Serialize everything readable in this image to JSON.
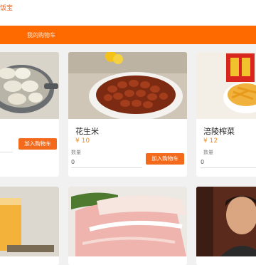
{
  "header": {
    "app_title": "饭宝"
  },
  "nav": {
    "cart_label": "我的购物车"
  },
  "products": [
    {
      "name": "",
      "price": "",
      "qty_label": "",
      "qty_value": "",
      "add_label": "加入购物车"
    },
    {
      "name": "花生米",
      "price": "¥ 10",
      "qty_label": "数量",
      "qty_value": "0",
      "add_label": "加入购物车"
    },
    {
      "name": "涪陵榨菜",
      "price": "¥ 12",
      "qty_label": "数量",
      "qty_value": "0",
      "add_label": ""
    }
  ],
  "colors": {
    "accent": "#ff6a00",
    "button": "#f36a1c",
    "price": "#e98c1f"
  },
  "icons": [
    "dumplings-image",
    "peanuts-image",
    "pickles-image",
    "drink-image",
    "pork-image",
    "person-photo"
  ]
}
